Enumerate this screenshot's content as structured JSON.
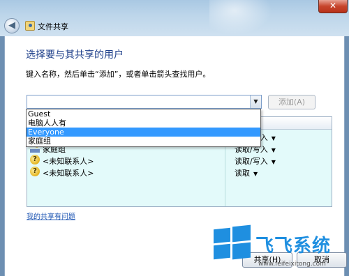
{
  "window": {
    "title": "文件共享",
    "close_label": "✕",
    "back_label": "◀"
  },
  "main": {
    "heading": "选择要与其共享的用户",
    "instruction": "键入名称，然后单击“添加”，或者单击箭头查找用户。",
    "combo_value": "",
    "add_button": "添加(A)",
    "help_link": "我的共享有问题"
  },
  "dropdown": {
    "items": [
      "Guest",
      "电脑人人有",
      "Everyone",
      "家庭组"
    ],
    "highlighted_index": 2
  },
  "grid": {
    "rows": [
      {
        "name": "家庭组",
        "permission": "读取/写入",
        "icon": "homegroup-icon"
      },
      {
        "name": "<未知联系人>",
        "permission": "读取/写入",
        "icon": "unknown-contact-icon"
      },
      {
        "name": "<未知联系人>",
        "permission": "读取",
        "icon": "unknown-contact-icon"
      }
    ],
    "partial_row_permission": "读取/写入"
  },
  "footer": {
    "share_button": "共享(H)",
    "cancel_button": "取消"
  },
  "watermark": {
    "text": "飞飞系统",
    "url": "www.feifeixitong.com"
  },
  "colors": {
    "heading": "#1e3f8a",
    "highlight": "#3399ff",
    "grid_bg": "#e3fafa",
    "watermark": "#1f8fe0"
  }
}
